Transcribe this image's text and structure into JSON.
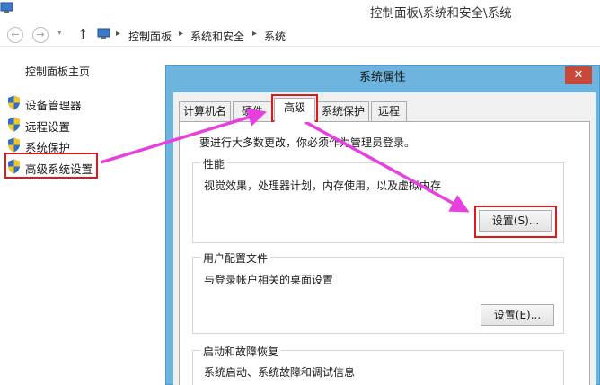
{
  "window": {
    "title": "控制面板\\系统和安全\\系统"
  },
  "navbar": {
    "back_icon": "←",
    "forward_icon": "→",
    "dropdown_icon": "▾",
    "up_icon": "↑",
    "breadcrumbs": [
      "控制面板",
      "系统和安全",
      "系统"
    ],
    "separator": "▸"
  },
  "left_pane": {
    "home_label": "控制面板主页",
    "items": [
      {
        "label": "设备管理器",
        "icon": "shield-icon"
      },
      {
        "label": "远程设置",
        "icon": "shield-icon"
      },
      {
        "label": "系统保护",
        "icon": "shield-icon"
      },
      {
        "label": "高级系统设置",
        "icon": "shield-icon",
        "highlighted": true
      }
    ]
  },
  "dialog": {
    "title": "系统属性",
    "close_label": "✕",
    "tabs": [
      {
        "label": "计算机名"
      },
      {
        "label": "硬件"
      },
      {
        "label": "高级",
        "active": true
      },
      {
        "label": "系统保护"
      },
      {
        "label": "远程"
      }
    ],
    "info_text": "要进行大多数更改，你必须作为管理员登录。",
    "groups": {
      "performance": {
        "title": "性能",
        "description": "视觉效果，处理器计划，内存使用，以及虚拟内存",
        "button_label": "设置(S)..."
      },
      "user_profiles": {
        "title": "用户配置文件",
        "description": "与登录帐户相关的桌面设置",
        "button_label": "设置(E)..."
      },
      "startup_recovery": {
        "title": "启动和故障恢复",
        "description": "系统启动、系统故障和调试信息"
      }
    }
  },
  "colors": {
    "dialog_frame": "#6db4de",
    "highlight_red": "#e0191c",
    "arrow_magenta": "#e83fe0",
    "close_red": "#c7493a"
  }
}
